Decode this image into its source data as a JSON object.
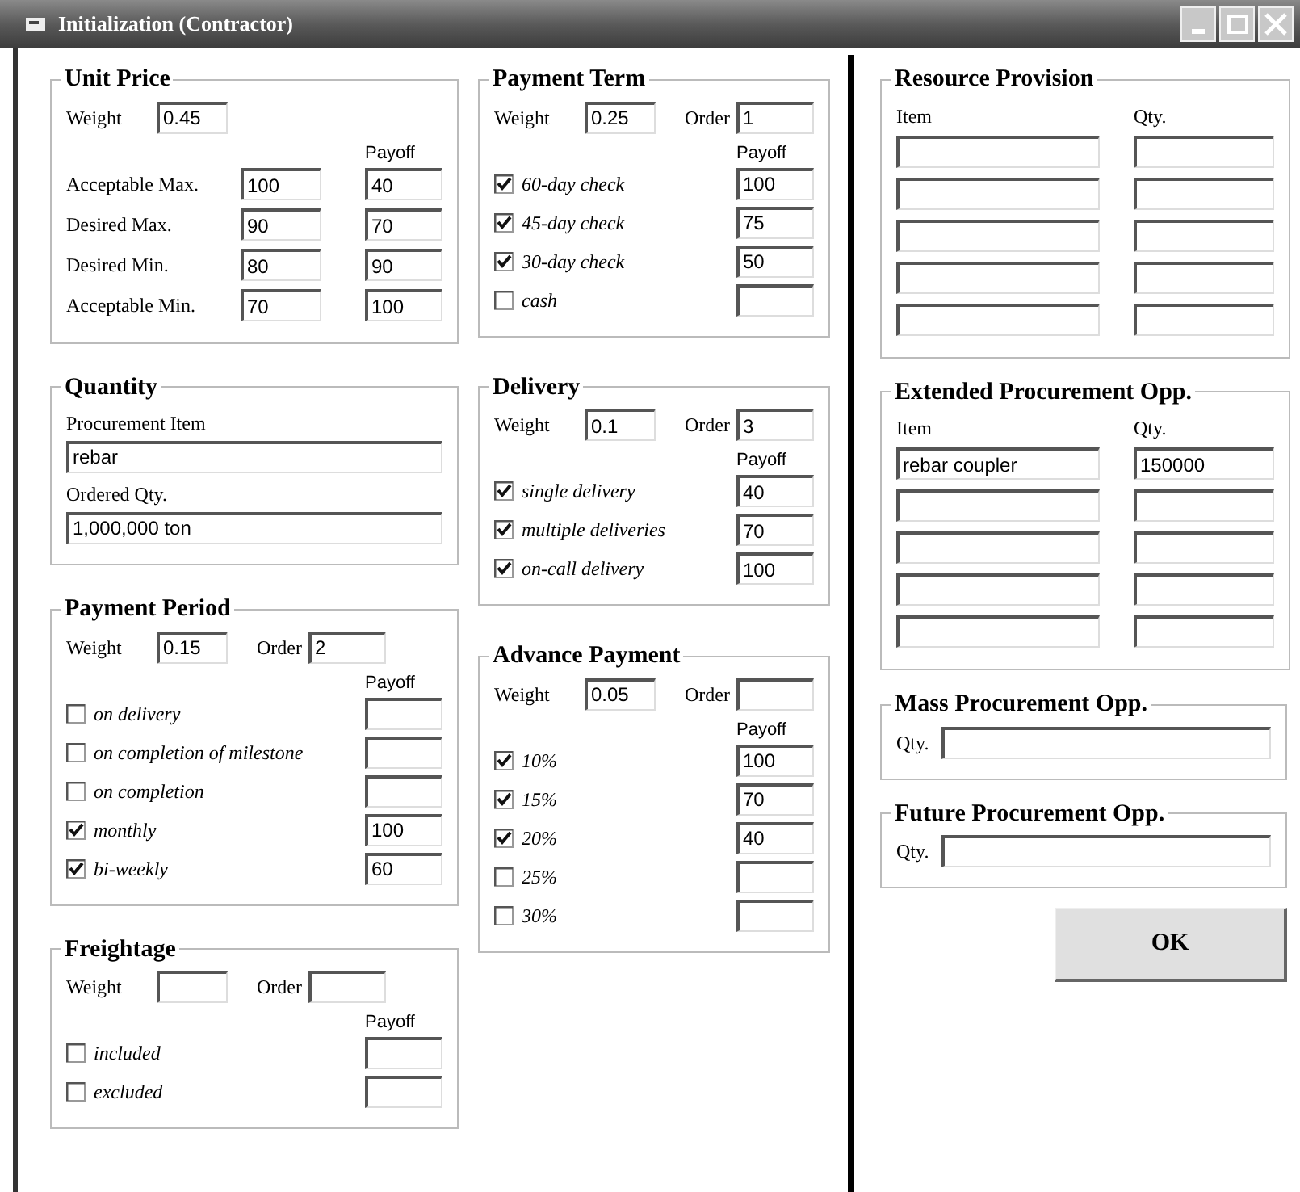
{
  "window": {
    "title": "Initialization (Contractor)"
  },
  "columns": [
    [
      {
        "kind": "price",
        "title": "Unit Price",
        "weight": {
          "label": "Weight",
          "value": "0.45"
        },
        "payoff_header": "Payoff",
        "rows": [
          {
            "label": "Acceptable Max.",
            "value": "100",
            "payoff": "40"
          },
          {
            "label": "Desired Max.",
            "value": "90",
            "payoff": "70"
          },
          {
            "label": "Desired Min.",
            "value": "80",
            "payoff": "90"
          },
          {
            "label": "Acceptable Min.",
            "value": "70",
            "payoff": "100"
          }
        ]
      },
      {
        "kind": "fields",
        "title": "Quantity",
        "fields": [
          {
            "label": "Procurement Item",
            "value": "rebar"
          },
          {
            "label": "Ordered Qty.",
            "value": "1,000,000 ton"
          }
        ]
      },
      {
        "kind": "options",
        "title": "Payment Period",
        "weight": {
          "label": "Weight",
          "value": "0.15"
        },
        "order": {
          "label": "Order",
          "value": "2"
        },
        "payoff_header": "Payoff",
        "options": [
          {
            "label": "on delivery",
            "checked": false
          },
          {
            "label": "on completion of milestone",
            "checked": false
          },
          {
            "label": "on completion",
            "checked": false
          },
          {
            "label": "monthly",
            "checked": true,
            "payoff": "100"
          },
          {
            "label": "bi-weekly",
            "checked": true,
            "payoff": "60"
          }
        ]
      },
      {
        "kind": "options",
        "title": "Freightage",
        "weight": {
          "label": "Weight"
        },
        "order": {
          "label": "Order"
        },
        "payoff_header": "Payoff",
        "options": [
          {
            "label": "included",
            "checked": false
          },
          {
            "label": "excluded",
            "checked": false
          }
        ]
      }
    ],
    [
      {
        "kind": "options",
        "title": "Payment Term",
        "weight": {
          "label": "Weight",
          "value": "0.25"
        },
        "order": {
          "label": "Order",
          "value": "1"
        },
        "payoff_header": "Payoff",
        "options": [
          {
            "label": "60-day check",
            "checked": true,
            "payoff": "100"
          },
          {
            "label": "45-day check",
            "checked": true,
            "payoff": "75"
          },
          {
            "label": "30-day check",
            "checked": true,
            "payoff": "50"
          },
          {
            "label": "cash",
            "checked": false
          }
        ]
      },
      {
        "kind": "options",
        "title": "Delivery",
        "weight": {
          "label": "Weight",
          "value": "0.1"
        },
        "order": {
          "label": "Order",
          "value": "3"
        },
        "payoff_header": "Payoff",
        "options": [
          {
            "label": "single delivery",
            "checked": true,
            "payoff": "40"
          },
          {
            "label": "multiple deliveries",
            "checked": true,
            "payoff": "70"
          },
          {
            "label": "on-call delivery",
            "checked": true,
            "payoff": "100"
          }
        ]
      },
      {
        "kind": "options",
        "title": "Advance Payment",
        "weight": {
          "label": "Weight",
          "value": "0.05"
        },
        "order": {
          "label": "Order"
        },
        "payoff_header": "Payoff",
        "options": [
          {
            "label": "10%",
            "checked": true,
            "payoff": "100"
          },
          {
            "label": "15%",
            "checked": true,
            "payoff": "70"
          },
          {
            "label": "20%",
            "checked": true,
            "payoff": "40"
          },
          {
            "label": "25%",
            "checked": false
          },
          {
            "label": "30%",
            "checked": false
          }
        ]
      }
    ],
    [
      {
        "kind": "item_qty",
        "title": "Resource Provision",
        "item_header": "Item",
        "qty_header": "Qty.",
        "rows": [
          {},
          {},
          {},
          {},
          {}
        ]
      },
      {
        "kind": "item_qty",
        "title": "Extended Procurement Opp.",
        "item_header": "Item",
        "qty_header": "Qty.",
        "rows": [
          {
            "item": "rebar coupler",
            "qty": "150000"
          },
          {},
          {},
          {},
          {}
        ]
      },
      {
        "kind": "qty",
        "title": "Mass Procurement Opp.",
        "label": "Qty."
      },
      {
        "kind": "qty",
        "title": "Future Procurement Opp.",
        "label": "Qty."
      }
    ]
  ],
  "ok_button": {
    "label": "OK"
  }
}
